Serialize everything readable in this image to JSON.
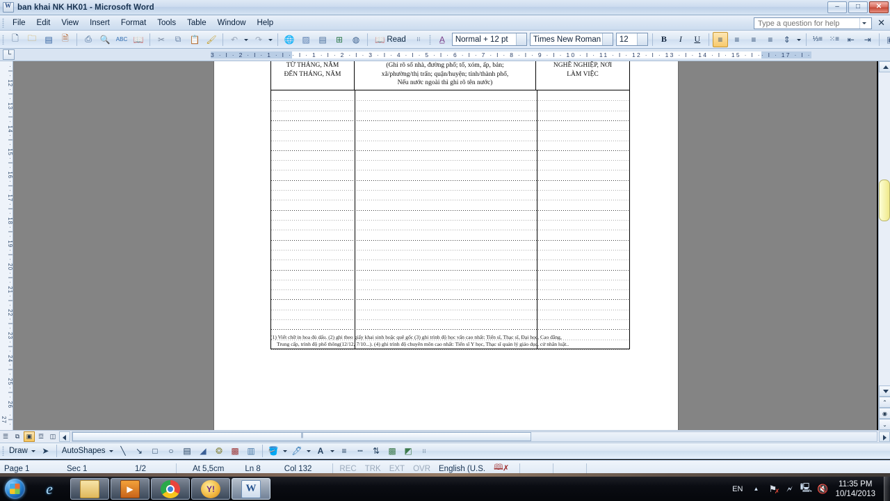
{
  "window": {
    "title": "ban khai NK HK01 - Microsoft Word",
    "app_icon": "word-document-icon",
    "minimize_glyph": "–",
    "maximize_glyph": "□",
    "close_glyph": "✕"
  },
  "menu": {
    "items": [
      {
        "label": "File"
      },
      {
        "label": "Edit"
      },
      {
        "label": "View"
      },
      {
        "label": "Insert"
      },
      {
        "label": "Format"
      },
      {
        "label": "Tools"
      },
      {
        "label": "Table"
      },
      {
        "label": "Window"
      },
      {
        "label": "Help"
      }
    ],
    "help_box": {
      "placeholder": "Type a question for help",
      "value": "",
      "close_glyph": "✕"
    }
  },
  "standard_toolbar": {
    "buttons": [
      {
        "name": "new-document-icon",
        "glyph": "὜b"
      },
      {
        "name": "open-icon",
        "glyph": "📂"
      },
      {
        "name": "save-icon",
        "glyph": "💾"
      },
      {
        "name": "permission-icon",
        "glyph": "🔒"
      },
      {
        "name": "print-icon",
        "glyph": "🖨"
      },
      {
        "name": "print-preview-icon",
        "glyph": "🔍"
      },
      {
        "name": "spelling-grammar-icon",
        "glyph": "ABC"
      },
      {
        "name": "research-icon",
        "glyph": "📖"
      },
      {
        "name": "cut-icon",
        "glyph": "✂"
      },
      {
        "name": "copy-icon",
        "glyph": "⧉"
      },
      {
        "name": "paste-icon",
        "glyph": "📋"
      },
      {
        "name": "format-painter-icon",
        "glyph": "🖌"
      },
      {
        "name": "undo-icon",
        "glyph": "↶"
      },
      {
        "name": "redo-icon",
        "glyph": "↷"
      },
      {
        "name": "insert-hyperlink-icon",
        "glyph": "🌐"
      },
      {
        "name": "insert-table-icon",
        "glyph": "▦"
      },
      {
        "name": "tables-and-borders-icon",
        "glyph": "▤"
      },
      {
        "name": "insert-excel-spreadsheet-icon",
        "glyph": "⊞"
      },
      {
        "name": "columns-icon",
        "glyph": "‖"
      },
      {
        "name": "drawing-icon",
        "glyph": "◩"
      },
      {
        "name": "document-map-icon",
        "glyph": "☷"
      },
      {
        "name": "show-formatting-icon",
        "glyph": "¶"
      },
      {
        "name": "zoom-icon",
        "glyph": "ⓘ"
      }
    ],
    "read_button": {
      "label": "Read",
      "icon": "book-icon"
    },
    "toolbar_options_icon": "toolbar-options-icon"
  },
  "formatting_toolbar": {
    "styles_icon": "styles-and-formatting-icon",
    "style": {
      "value": "Normal + 12 pt"
    },
    "font": {
      "value": "Times New Roman"
    },
    "size": {
      "value": "12"
    },
    "bold": {
      "label": "B"
    },
    "italic": {
      "label": "I"
    },
    "underline": {
      "label": "U"
    },
    "align_left": {
      "name": "align-left-icon",
      "active": true
    },
    "align_center": {
      "name": "align-center-icon"
    },
    "align_right": {
      "name": "align-right-icon"
    },
    "align_justify": {
      "name": "align-justify-icon"
    },
    "line_spacing": {
      "name": "line-spacing-icon"
    },
    "numbering": {
      "name": "numbered-list-icon"
    },
    "bullets": {
      "name": "bulleted-list-icon"
    },
    "decrease_indent": {
      "name": "decrease-indent-icon"
    },
    "increase_indent": {
      "name": "increase-indent-icon"
    },
    "borders": {
      "name": "borders-icon"
    },
    "highlight": {
      "name": "highlight-color-icon"
    },
    "font_color": {
      "name": "font-color-icon"
    }
  },
  "ruler": {
    "tab_selector_glyph": "└",
    "horizontal_left_outside": "3 · I · 2 · I · 1 · I ·",
    "horizontal_inside": "· I · 1 · I · 2 · I · 3 · I · 4 · I · 5 · I · 6 · I · 7 · I · 8 · I · 9 · I · 10 · I · 11 · I · 12 · I · 13 · I · 14 · I · 15 · I ·",
    "horizontal_right_outside": "· I · 17 · I ·",
    "vertical_ticks": [
      "12",
      "13",
      "14",
      "15",
      "16",
      "17",
      "18",
      "19",
      "20",
      "21",
      "22",
      "23",
      "24",
      "25",
      "26",
      "27"
    ]
  },
  "document": {
    "table": {
      "columns": [
        {
          "header_lines": [
            "TỪ THÁNG, NĂM",
            "ĐẾN THÁNG, NĂM"
          ]
        },
        {
          "header_lines": [
            "(Ghi rõ số nhà, đường phố; tổ, xóm, ấp, bản;",
            "xã/phường/thị trấn; quận/huyện; tỉnh/thành phố,",
            "Nếu nước ngoài thì ghi rõ tên nước)"
          ]
        },
        {
          "header_lines": [
            "NGHỀ NGHIỆP, NƠI",
            "LÀM VIỆC"
          ]
        }
      ],
      "empty_row_count": 26
    },
    "footnote_line1": "(1) Viết chữ in hoa đủ dấu. (2) ghi theo giấy khai sinh hoặc quê gốc  (3) ghi trình độ học vấn cao nhất: Tiến sĩ, Thạc sĩ, Đại học, Cao đẳng,",
    "footnote_line2": "Trung cấp, trình độ phổ thông(12/12, 7/10...). (4) ghi trình độ chuyên môn cao nhất: Tiến sĩ Y học, Thạc sĩ quản lý giáo dục, cử nhân luật.."
  },
  "view_buttons": [
    {
      "name": "normal-view-button",
      "glyph": "☰",
      "selected": false
    },
    {
      "name": "web-layout-view-button",
      "glyph": "⧉",
      "selected": false
    },
    {
      "name": "print-layout-view-button",
      "glyph": "▣",
      "selected": true
    },
    {
      "name": "outline-view-button",
      "glyph": "☲",
      "selected": false
    },
    {
      "name": "reading-layout-view-button",
      "glyph": "◫",
      "selected": false
    }
  ],
  "drawing_toolbar": {
    "draw_menu": {
      "label": "Draw"
    },
    "select_objects": {
      "name": "select-objects-icon",
      "glyph": "➤"
    },
    "autoshapes_menu": {
      "label": "AutoShapes"
    },
    "tools": [
      {
        "name": "line-icon",
        "glyph": "╲"
      },
      {
        "name": "arrow-icon",
        "glyph": "↘"
      },
      {
        "name": "rectangle-icon",
        "glyph": "□"
      },
      {
        "name": "oval-icon",
        "glyph": "○"
      },
      {
        "name": "text-box-icon",
        "glyph": "▤"
      },
      {
        "name": "insert-wordart-icon",
        "glyph": "◥"
      },
      {
        "name": "insert-diagram-icon",
        "glyph": "☸"
      },
      {
        "name": "insert-clip-art-icon",
        "glyph": "⚘"
      },
      {
        "name": "insert-picture-icon",
        "glyph": "⛰"
      },
      {
        "name": "fill-color-icon",
        "glyph": "🪣"
      },
      {
        "name": "line-color-icon",
        "glyph": "🖊"
      },
      {
        "name": "font-color-icon",
        "glyph": "A"
      },
      {
        "name": "line-style-icon",
        "glyph": "≡"
      },
      {
        "name": "dash-style-icon",
        "glyph": "┉"
      },
      {
        "name": "arrow-style-icon",
        "glyph": "⇅"
      },
      {
        "name": "shadow-style-icon",
        "glyph": "▨"
      },
      {
        "name": "3d-style-icon",
        "glyph": "◰"
      }
    ]
  },
  "status_bar": {
    "page": "Page 1",
    "section": "Sec 1",
    "page_of": "1/2",
    "at": "At 5,5cm",
    "line": "Ln 8",
    "column": "Col 132",
    "rec": "REC",
    "trk": "TRK",
    "ext": "EXT",
    "ovr": "OVR",
    "language": "English (U.S.",
    "spelling_icon": "spelling-status-icon"
  },
  "taskbar": {
    "start_button": {
      "name": "start-orb"
    },
    "items": [
      {
        "name": "taskbar-internet-explorer",
        "glyph": "e",
        "open": false
      },
      {
        "name": "taskbar-windows-explorer",
        "glyph": "📁",
        "open": true
      },
      {
        "name": "taskbar-media-player",
        "glyph": "▶",
        "open": true
      },
      {
        "name": "taskbar-google-chrome",
        "glyph": "◉",
        "open": true
      },
      {
        "name": "taskbar-yahoo-messenger",
        "glyph": "Y!",
        "open": true
      },
      {
        "name": "taskbar-microsoft-word",
        "glyph": "W",
        "open": true
      }
    ],
    "tray": {
      "language": "EN",
      "show_hidden_glyph": "▲",
      "icons": [
        {
          "name": "network-flag-icon",
          "glyph": "⚑"
        },
        {
          "name": "action-center-icon",
          "glyph": "⚑"
        },
        {
          "name": "network-icon",
          "glyph": "🖧"
        },
        {
          "name": "volume-muted-icon",
          "glyph": "🔇"
        }
      ],
      "time": "11:35 PM",
      "date": "10/14/2013"
    }
  }
}
